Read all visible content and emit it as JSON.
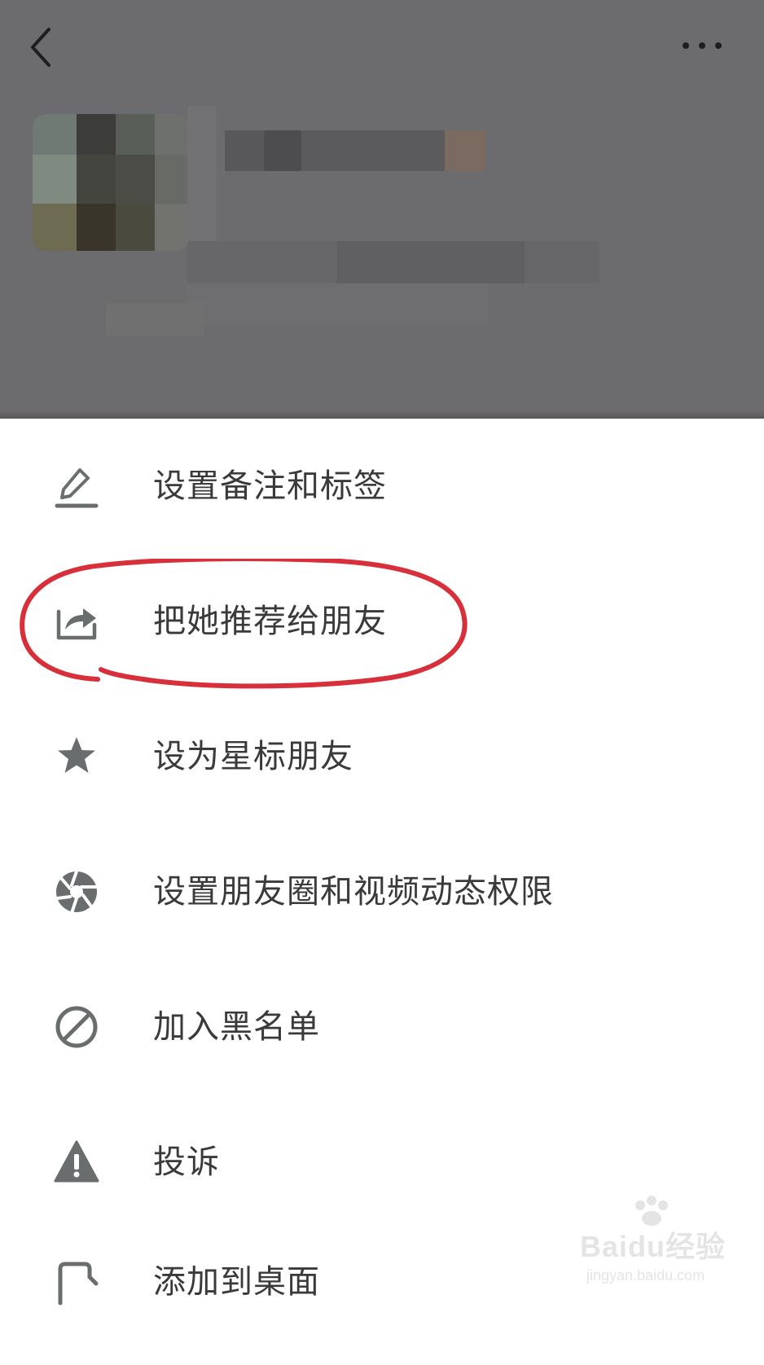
{
  "header": {
    "back_icon": "chevron-left-icon",
    "more_icon": "more-horizontal-icon"
  },
  "menu": {
    "items": [
      {
        "label": "设置备注和标签",
        "icon": "edit-pencil-icon"
      },
      {
        "label": "把她推荐给朋友",
        "icon": "share-forward-icon"
      },
      {
        "label": "设为星标朋友",
        "icon": "star-icon"
      },
      {
        "label": "设置朋友圈和视频动态权限",
        "icon": "aperture-icon"
      },
      {
        "label": "加入黑名单",
        "icon": "block-icon"
      },
      {
        "label": "投诉",
        "icon": "warning-icon"
      },
      {
        "label": "添加到桌面",
        "icon": "add-to-desktop-icon"
      }
    ]
  },
  "annotation": {
    "color": "#d8303a",
    "highlighted_item": "把她推荐给朋友"
  },
  "watermark": {
    "main": "Baidu经验",
    "sub": "jingyan.baidu.com"
  },
  "colors": {
    "dim_overlay": "#6c6b6d",
    "icon": "#6a6d6e",
    "text": "#3a3a3a"
  }
}
